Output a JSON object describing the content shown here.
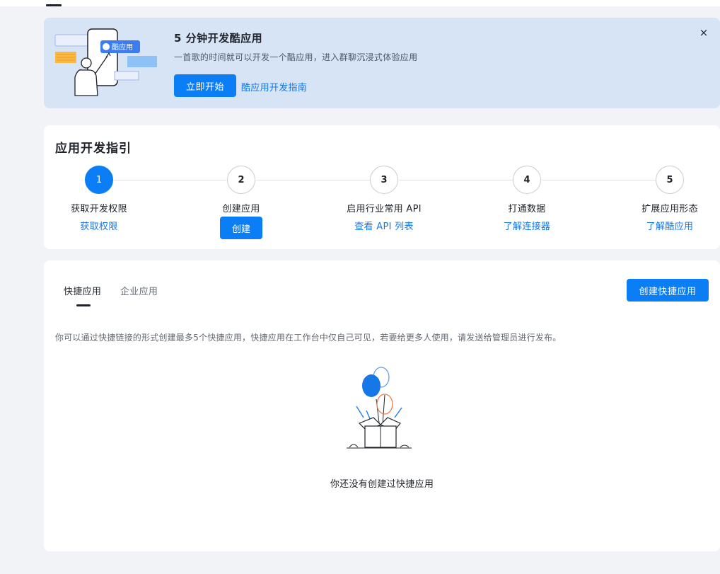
{
  "banner": {
    "badge_label": "酷应用",
    "title": "5 分钟开发酷应用",
    "description": "一首歌的时间就可以开发一个酷应用，进入群聊沉浸式体验应用",
    "start_button": "立即开始",
    "guide_link": "酷应用开发指南",
    "close_icon": "×"
  },
  "guide": {
    "title": "应用开发指引",
    "steps": [
      {
        "number": "1",
        "label": "获取开发权限",
        "action": "获取权限",
        "action_type": "link",
        "active": true
      },
      {
        "number": "2",
        "label": "创建应用",
        "action": "创建",
        "action_type": "button",
        "active": false
      },
      {
        "number": "3",
        "label": "启用行业常用 API",
        "action": "查看 API 列表",
        "action_type": "link",
        "active": false
      },
      {
        "number": "4",
        "label": "打通数据",
        "action": "了解连接器",
        "action_type": "link",
        "active": false
      },
      {
        "number": "5",
        "label": "扩展应用形态",
        "action": "了解酷应用",
        "action_type": "link",
        "active": false
      }
    ]
  },
  "apps": {
    "tabs": [
      {
        "label": "快捷应用",
        "active": true
      },
      {
        "label": "企业应用",
        "active": false
      }
    ],
    "create_button": "创建快捷应用",
    "hint": "你可以通过快捷链接的形式创建最多5个快捷应用，快捷应用在工作台中仅自己可见，若要给更多人使用，请发送给管理员进行发布。",
    "empty_text": "你还没有创建过快捷应用"
  },
  "colors": {
    "primary": "#0b7ef5",
    "link": "#1677e6",
    "banner_bg": "#d7e4f6",
    "page_bg": "#f2f3f7"
  }
}
